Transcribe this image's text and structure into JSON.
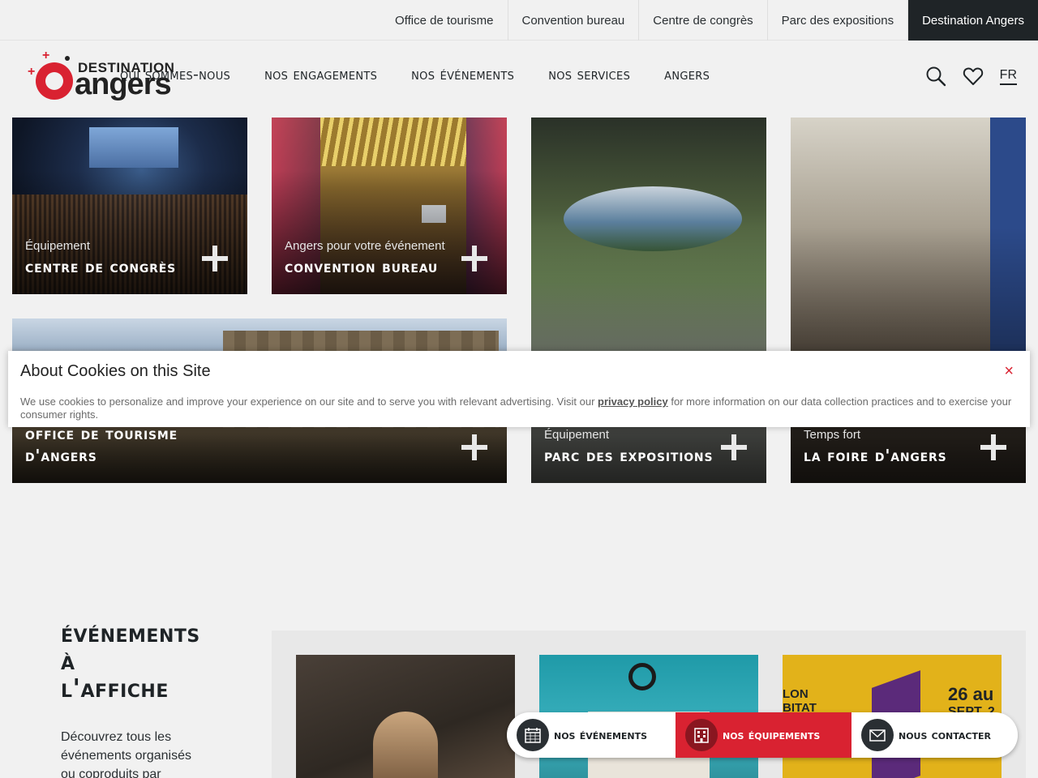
{
  "topbar": {
    "links": [
      "Office de tourisme",
      "Convention bureau",
      "Centre de congrès",
      "Parc des expositions",
      "Destination Angers"
    ]
  },
  "logo": {
    "line1": "DESTINATION",
    "line2": "angers"
  },
  "mainnav": {
    "items": [
      "qui sommes-nous",
      "nos engagements",
      "nos événements",
      "nos services",
      "angers"
    ]
  },
  "header": {
    "lang": "FR",
    "icons": [
      "search-icon",
      "heart-icon"
    ]
  },
  "tiles": [
    {
      "kicker": "Équipement",
      "title": "centre de congrès"
    },
    {
      "kicker": "Angers pour votre événement",
      "title": "convention bureau"
    },
    {
      "kicker": "",
      "title": "office de tourisme d'angers"
    },
    {
      "kicker": "Équipement",
      "title": "parc des expositions"
    },
    {
      "kicker": "Temps fort",
      "title": "la foire d'angers"
    }
  ],
  "cookie": {
    "title": "About Cookies on this Site",
    "text_before": "We use cookies to personalize and improve your experience on our site and to serve you with relevant advertising. Visit our ",
    "link": "privacy policy",
    "text_after": " for more information on our data collection practices and to exercise your consumer rights.",
    "close": "×"
  },
  "events": {
    "heading_line1": "événements",
    "heading_line2": "à",
    "heading_line3": "l'affiche",
    "intro": "Découvrez tous les événements organisés ou coproduits par",
    "card3_text_a": "26 au",
    "card3_text_b": "SEPT. 2",
    "card3_text_c": "LON",
    "card3_text_d": "BITAT"
  },
  "floatbar": {
    "items": [
      {
        "label": "nos événements",
        "icon": "calendar-icon"
      },
      {
        "label": "nos équipements",
        "icon": "building-icon"
      },
      {
        "label": "nous contacter",
        "icon": "envelope-icon"
      }
    ]
  },
  "colors": {
    "accent": "#d92231",
    "dark": "#1f2427",
    "background": "#f1f1f1"
  }
}
